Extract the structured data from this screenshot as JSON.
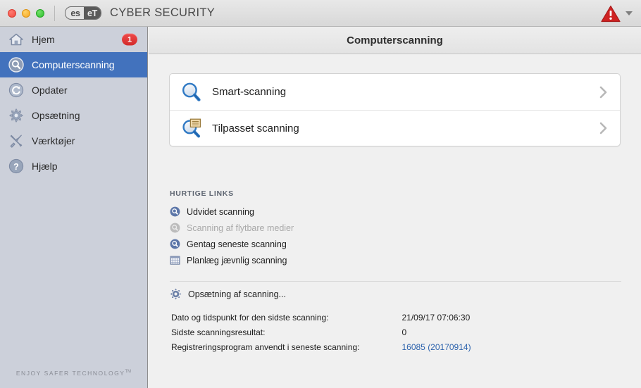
{
  "window": {
    "brand": "CYBER SECURITY",
    "logo_left": "es",
    "logo_right": "eT",
    "logo_tm": "®",
    "traffic_close": "close-button",
    "traffic_minimize": "minimize-button",
    "traffic_zoom": "zoom-button",
    "alert_icon": "warning-triangle-icon",
    "alert_caret": "chevron-down-icon"
  },
  "sidebar": {
    "items": [
      {
        "label": "Hjem",
        "icon": "home-icon",
        "selected": false,
        "badge": "1"
      },
      {
        "label": "Computerscanning",
        "icon": "magnifier-circle-icon",
        "selected": true,
        "badge": ""
      },
      {
        "label": "Opdater",
        "icon": "refresh-circle-icon",
        "selected": false,
        "badge": ""
      },
      {
        "label": "Opsætning",
        "icon": "gear-icon",
        "selected": false,
        "badge": ""
      },
      {
        "label": "Værktøjer",
        "icon": "tools-icon",
        "selected": false,
        "badge": ""
      },
      {
        "label": "Hjælp",
        "icon": "question-circle-icon",
        "selected": false,
        "badge": ""
      }
    ],
    "tagline": "ENJOY SAFER TECHNOLOGY",
    "tagline_tm": "TM"
  },
  "main": {
    "title": "Computerscanning",
    "scan_options": [
      {
        "label": "Smart-scanning",
        "icon": "magnifier-icon"
      },
      {
        "label": "Tilpasset scanning",
        "icon": "magnifier-document-icon"
      }
    ],
    "quick_links_header": "HURTIGE LINKS",
    "quick_links": [
      {
        "label": "Udvidet scanning",
        "icon": "magnifier-circle-icon",
        "disabled": false
      },
      {
        "label": "Scanning af flytbare medier",
        "icon": "magnifier-circle-icon",
        "disabled": true
      },
      {
        "label": "Gentag seneste scanning",
        "icon": "magnifier-circle-icon",
        "disabled": false
      },
      {
        "label": "Planlæg jævnlig scanning",
        "icon": "calendar-icon",
        "disabled": false
      }
    ],
    "settings_link": {
      "label": "Opsætning af scanning...",
      "icon": "gear-icon"
    },
    "info_rows": [
      {
        "key": "Dato og tidspunkt for den sidste scanning:",
        "value": "21/09/17 07:06:30",
        "link": false
      },
      {
        "key": "Sidste scanningsresultat:",
        "value": "0",
        "link": false
      },
      {
        "key": "Registreringsprogram anvendt i seneste scanning:",
        "value": "16085 (20170914)",
        "link": true
      }
    ]
  },
  "colors": {
    "accent": "#4272bd",
    "sidebar_bg": "#ccd0da",
    "content_bg": "#f0f0f0",
    "badge_red": "#d32b2b",
    "link_blue": "#2d63ad"
  }
}
